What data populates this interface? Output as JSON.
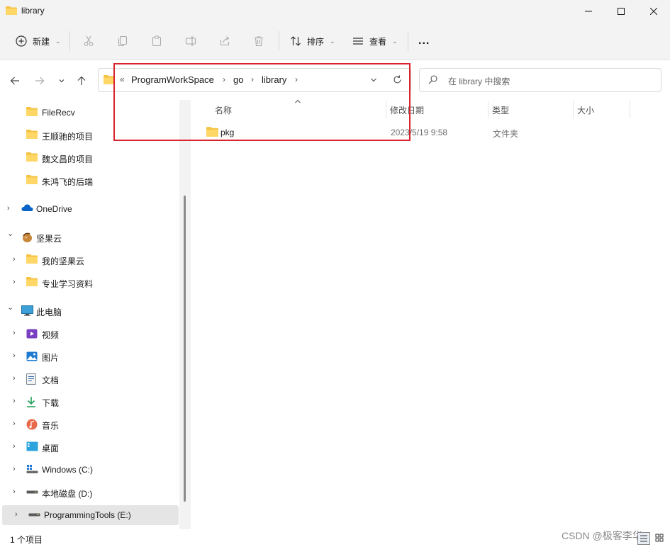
{
  "window": {
    "title": "library"
  },
  "toolbar": {
    "new_label": "新建",
    "sort_label": "排序",
    "view_label": "查看",
    "more_label": "..."
  },
  "address": {
    "overflow": "«",
    "crumbs": [
      "ProgramWorkSpace",
      "go",
      "library"
    ]
  },
  "search": {
    "placeholder": "在 library 中搜索"
  },
  "sidebar": {
    "items": [
      {
        "label": "FileRecv",
        "icon": "folder-icon"
      },
      {
        "label": "王顺驰的项目",
        "icon": "folder-icon"
      },
      {
        "label": "魏文昌的项目",
        "icon": "folder-icon"
      },
      {
        "label": "朱鸿飞的后端",
        "icon": "folder-icon"
      },
      {
        "label": "OneDrive",
        "icon": "cloud-icon"
      },
      {
        "label": "坚果云",
        "icon": "nut-icon"
      },
      {
        "label": "我的坚果云",
        "icon": "folder-icon"
      },
      {
        "label": "专业学习资料",
        "icon": "folder-icon"
      },
      {
        "label": "此电脑",
        "icon": "computer-icon"
      },
      {
        "label": "视频",
        "icon": "video-icon"
      },
      {
        "label": "图片",
        "icon": "picture-icon"
      },
      {
        "label": "文档",
        "icon": "document-icon"
      },
      {
        "label": "下载",
        "icon": "download-icon"
      },
      {
        "label": "音乐",
        "icon": "music-icon"
      },
      {
        "label": "桌面",
        "icon": "desktop-icon"
      },
      {
        "label": "Windows (C:)",
        "icon": "windows-drive-icon"
      },
      {
        "label": "本地磁盘 (D:)",
        "icon": "drive-icon"
      },
      {
        "label": "ProgrammingTools (E:)",
        "icon": "drive-icon"
      }
    ]
  },
  "columns": {
    "name": "名称",
    "modified": "修改日期",
    "type": "类型",
    "size": "大小"
  },
  "files": [
    {
      "name": "pkg",
      "modified": "2023/5/19 9:58",
      "type": "文件夹",
      "size": ""
    }
  ],
  "status": {
    "count": "1 个项目"
  },
  "watermark": "CSDN @极客李华",
  "colors": {
    "folder": "#f5c242",
    "highlight": "#d9232d",
    "accent": "#0067c0"
  }
}
